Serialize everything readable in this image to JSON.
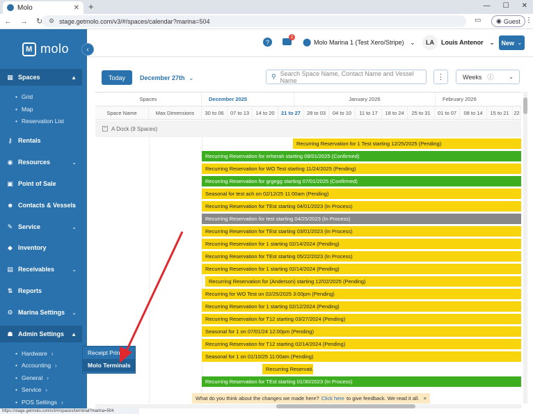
{
  "browser": {
    "tab_title": "Molo",
    "url": "stage.getmolo.com/v3/#/spaces/calendar?marina=504",
    "guest_label": "Guest",
    "status_url": "https://stage.getmolo.com/v3/#/spaces/terminal?marina=504"
  },
  "sidebar": {
    "logo_text": "molo",
    "items": [
      {
        "label": "Spaces",
        "icon": "grid-icon",
        "top": 0
      },
      {
        "label": "Rentals"
      },
      {
        "label": "Resources"
      },
      {
        "label": "Point of Sale"
      },
      {
        "label": "Contacts & Vessels"
      },
      {
        "label": "Service"
      },
      {
        "label": "Inventory"
      },
      {
        "label": "Receivables"
      },
      {
        "label": "Reports"
      },
      {
        "label": "Marina Settings"
      },
      {
        "label": "Admin Settings"
      }
    ],
    "spaces_sub": [
      "Grid",
      "Map",
      "Reservation List"
    ],
    "admin_sub": [
      "Hardware",
      "Accounting",
      "General",
      "Service",
      "POS Settings"
    ],
    "flyout": [
      "Receipt Printers",
      "Molo Terminals"
    ]
  },
  "topbar": {
    "mail_count": "2",
    "marina": "Molo Marina 1 (Test Xero/Stripe)",
    "avatar": "LA",
    "user": "Louis Antenor",
    "new_label": "New"
  },
  "toolbar": {
    "today": "Today",
    "month": "December 27th",
    "search_placeholder": "Search Space Name, Contact Name and Vessel Name",
    "view": "Weeks"
  },
  "grid": {
    "spaces_label": "Spaces",
    "months": [
      "December 2025",
      "January 2026",
      "February 2026"
    ],
    "col_space": "Space Name",
    "col_dim": "Max Dimensions",
    "weeks": [
      "30 to 06",
      "07 to 13",
      "14 to 20",
      "21 to 27",
      "28 to 03",
      "04 to 10",
      "11 to 17",
      "18 to 24",
      "25 to 31",
      "01 to 07",
      "08 to 14",
      "15 to 21",
      "22"
    ],
    "group": "A Dock (9 Spaces)",
    "bars": [
      {
        "text": "Recurring Reservation for 1 Test starting 12/25/2025 (Pending)",
        "type": "p"
      },
      {
        "text": "Recurring Reservation for erherah starting 08/01/2025 (Confirmed)",
        "type": "c"
      },
      {
        "text": "Recurring Reservation for WO Test starting 11/24/2025 (Pending)",
        "type": "p"
      },
      {
        "text": "Recurring Reservation for grgegg starting 07/01/2025 (Confirmed)",
        "type": "c"
      },
      {
        "text": "Seasonal for test ach on 02/12/25 11:00am (Pending)",
        "type": "p"
      },
      {
        "text": "Recurring Reservation for TEst starting 04/01/2023 (In Process)",
        "type": "p"
      },
      {
        "text": "Recurring Reservation for test starting 04/25/2023 (In Process)",
        "type": "g"
      },
      {
        "text": "Recurring Reservation for TEst starting 03/01/2023 (In Process)",
        "type": "p"
      },
      {
        "text": "Recurring Reservation for 1 starting 02/14/2024 (Pending)",
        "type": "p"
      },
      {
        "text": "Recurring Reservation for TEst starting 05/22/2023 (In Process)",
        "type": "p"
      },
      {
        "text": "Recurring Reservation for 1 starting 02/14/2024 (Pending)",
        "type": "p"
      },
      {
        "text": "Recurring Reservation for (Anderson) starting 12/02/2025 (Pending)",
        "type": "p"
      },
      {
        "text": "Recurring for WO Test on 02/25/2025 3:00pm (Pending)",
        "type": "p"
      },
      {
        "text": "Recurring Reservation for 1 starting 02/12/2024 (Pending)",
        "type": "p"
      },
      {
        "text": "Recurring Reservation for T12 starting 03/27/2024 (Pending)",
        "type": "p"
      },
      {
        "text": "Seasonal for 1 on 07/01/24 12:00pm (Pending)",
        "type": "p"
      },
      {
        "text": "Recurring Reservation for T12 starting 02/14/2024 (Pending)",
        "type": "p"
      },
      {
        "text": "Seasonal for 1 on 01/10/25 11:00am (Pending)",
        "type": "p"
      },
      {
        "text": "Recurring Reservati...",
        "type": "p"
      },
      {
        "text": "Recurring Reservation for TEst starting 01/30/2023 (In Process)",
        "type": "c"
      }
    ]
  },
  "feedback": {
    "pre": "What do you think about the changes we made here?",
    "link": "Click here",
    "post": "to give feedback. We read it all.",
    "close": "×"
  },
  "colors": {
    "sidebar": "#2a72ad",
    "pending": "#f7d40c",
    "confirmed": "#3dae1f",
    "in_process_grey": "#888888",
    "annotation_arrow": "#e0282e"
  }
}
